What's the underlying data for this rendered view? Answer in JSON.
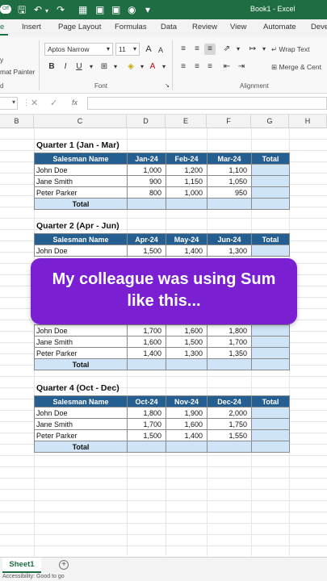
{
  "window": {
    "title": "Book1 - Excel",
    "autosave": "Off"
  },
  "ribbon_tabs": [
    "e",
    "Insert",
    "Page Layout",
    "Formulas",
    "Data",
    "Review",
    "View",
    "Automate",
    "Deve"
  ],
  "ribbon": {
    "font_name": "Aptos Narrow",
    "font_size": "11",
    "bold": "B",
    "italic": "I",
    "underline": "U",
    "wrap_text": "Wrap Text",
    "merge_center": "Merge & Cent",
    "format_painter": "mat Painter",
    "cut_fragment": "y",
    "group_clipboard": "d",
    "group_font": "Font",
    "group_alignment": "Alignment",
    "increase_font": "A",
    "decrease_font": "A"
  },
  "formula_bar": {
    "fx": "fx",
    "value": ""
  },
  "columns": [
    "B",
    "C",
    "D",
    "E",
    "F",
    "G",
    "H"
  ],
  "quarters": [
    {
      "title": "Quarter 1 (Jan - Mar)",
      "headers": [
        "Salesman Name",
        "Jan-24",
        "Feb-24",
        "Mar-24",
        "Total"
      ],
      "rows": [
        {
          "name": "John Doe",
          "values": [
            "1,000",
            "1,200",
            "1,100"
          ]
        },
        {
          "name": "Jane Smith",
          "values": [
            "900",
            "1,150",
            "1,050"
          ]
        },
        {
          "name": "Peter Parker",
          "values": [
            "800",
            "1,000",
            "950"
          ]
        }
      ],
      "total_label": "Total"
    },
    {
      "title": "Quarter 2 (Apr - Jun)",
      "headers": [
        "Salesman Name",
        "Apr-24",
        "May-24",
        "Jun-24",
        "Total"
      ],
      "rows": [
        {
          "name": "John Doe",
          "values": [
            "1,500",
            "1,400",
            "1,300"
          ]
        }
      ]
    },
    {
      "title": "",
      "rows": [
        {
          "name": "John Doe",
          "values": [
            "1,700",
            "1,600",
            "1,800"
          ]
        },
        {
          "name": "Jane Smith",
          "values": [
            "1,600",
            "1,500",
            "1,700"
          ]
        },
        {
          "name": "Peter Parker",
          "values": [
            "1,400",
            "1,300",
            "1,350"
          ]
        }
      ],
      "total_label": "Total"
    },
    {
      "title": "Quarter 4 (Oct - Dec)",
      "headers": [
        "Salesman Name",
        "Oct-24",
        "Nov-24",
        "Dec-24",
        "Total"
      ],
      "rows": [
        {
          "name": "John Doe",
          "values": [
            "1,800",
            "1,900",
            "2,000"
          ]
        },
        {
          "name": "Jane Smith",
          "values": [
            "1,700",
            "1,600",
            "1,750"
          ]
        },
        {
          "name": "Peter Parker",
          "values": [
            "1,500",
            "1,400",
            "1,550"
          ]
        }
      ],
      "total_label": "Total"
    }
  ],
  "overlay": {
    "line1": "My colleague was using Sum",
    "line2": "like this..."
  },
  "sheet_tabs": {
    "active": "Sheet1",
    "add": "+"
  },
  "status": {
    "accessibility": "Accessibility: Good to go"
  },
  "colors": {
    "excel_green": "#1f6e43",
    "header_blue": "#255e91",
    "total_fill": "#cfe4f7",
    "overlay_purple": "#7a1fd1"
  }
}
